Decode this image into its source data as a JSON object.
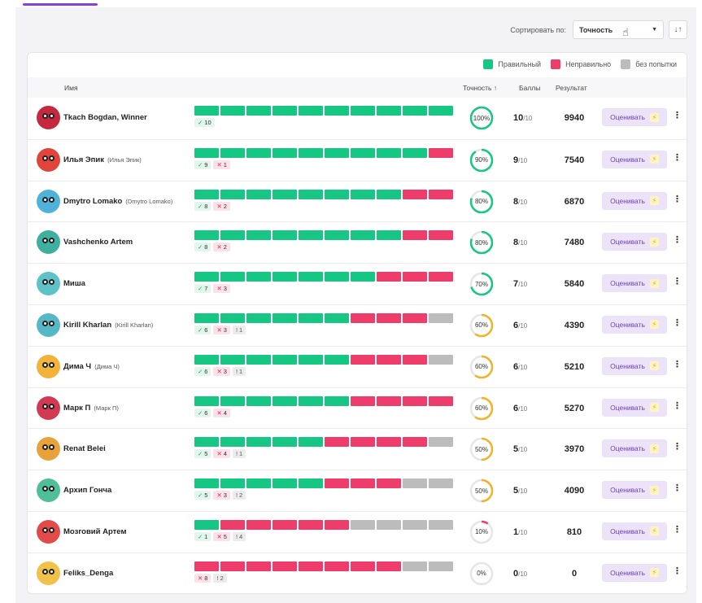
{
  "sort": {
    "label": "Сортировать по:",
    "selected": "Точность"
  },
  "legend": [
    {
      "label": "Правильный",
      "color": "#16c784"
    },
    {
      "label": "Неправильно",
      "color": "#ee3d6a"
    },
    {
      "label": "без попытки",
      "color": "#bcbcbc"
    }
  ],
  "columns": {
    "name": "Имя",
    "accuracy": "Точность ↑",
    "points": "Баллы",
    "result": "Результат"
  },
  "rate_label": "Оценивать",
  "total": "/10",
  "colors": {
    "correct": "#16c784",
    "wrong": "#ee3d6a",
    "skip": "#bcbcbc",
    "ring_green": "#16c784",
    "ring_yellow": "#f0b42a",
    "ring_red": "#ee3d6a"
  },
  "rows": [
    {
      "name": "Tkach Bogdan, Winner",
      "alias": "",
      "correct": 10,
      "wrong": 0,
      "skip": 0,
      "accuracy": "100%",
      "points": "10",
      "result": "9940",
      "avatar_color": "#c6283e"
    },
    {
      "name": "Илья Эпик",
      "alias": "(Илья Эпик)",
      "correct": 9,
      "wrong": 1,
      "skip": 0,
      "accuracy": "90%",
      "points": "9",
      "result": "7540",
      "avatar_color": "#e0443a"
    },
    {
      "name": "Dmytro Lomako",
      "alias": "(Dmytro Lomako)",
      "correct": 8,
      "wrong": 2,
      "skip": 0,
      "accuracy": "80%",
      "points": "8",
      "result": "6870",
      "avatar_color": "#4fb3d9"
    },
    {
      "name": "Vashchenko Artem",
      "alias": "",
      "correct": 8,
      "wrong": 2,
      "skip": 0,
      "accuracy": "80%",
      "points": "8",
      "result": "7480",
      "avatar_color": "#3fb0a0"
    },
    {
      "name": "Миша",
      "alias": "",
      "correct": 7,
      "wrong": 3,
      "skip": 0,
      "accuracy": "70%",
      "points": "7",
      "result": "5840",
      "avatar_color": "#5fc2c9"
    },
    {
      "name": "Kirill Kharlan",
      "alias": "(Kirill Kharlan)",
      "correct": 6,
      "wrong": 3,
      "skip": 1,
      "accuracy": "60%",
      "points": "6",
      "result": "4390",
      "avatar_color": "#56b8c4"
    },
    {
      "name": "Дима Ч",
      "alias": "(Дима Ч)",
      "correct": 6,
      "wrong": 3,
      "skip": 1,
      "accuracy": "60%",
      "points": "6",
      "result": "5210",
      "avatar_color": "#f2b33a"
    },
    {
      "name": "Марк П",
      "alias": "(Марк П)",
      "correct": 6,
      "wrong": 4,
      "skip": 0,
      "accuracy": "60%",
      "points": "6",
      "result": "5270",
      "avatar_color": "#d23a52"
    },
    {
      "name": "Renat Belei",
      "alias": "",
      "correct": 5,
      "wrong": 4,
      "skip": 1,
      "accuracy": "50%",
      "points": "5",
      "result": "3970",
      "avatar_color": "#e9a23a"
    },
    {
      "name": "Архип Гонча",
      "alias": "",
      "correct": 5,
      "wrong": 3,
      "skip": 2,
      "accuracy": "50%",
      "points": "5",
      "result": "4090",
      "avatar_color": "#4fbf9a"
    },
    {
      "name": "Мозговий Артем",
      "alias": "",
      "correct": 1,
      "wrong": 5,
      "skip": 4,
      "accuracy": "10%",
      "points": "1",
      "result": "810",
      "avatar_color": "#e34a4a"
    },
    {
      "name": "Feliks_Denga",
      "alias": "",
      "correct": 0,
      "wrong": 8,
      "skip": 2,
      "accuracy": "0%",
      "points": "0",
      "result": "0",
      "avatar_color": "#f2c14a"
    }
  ]
}
